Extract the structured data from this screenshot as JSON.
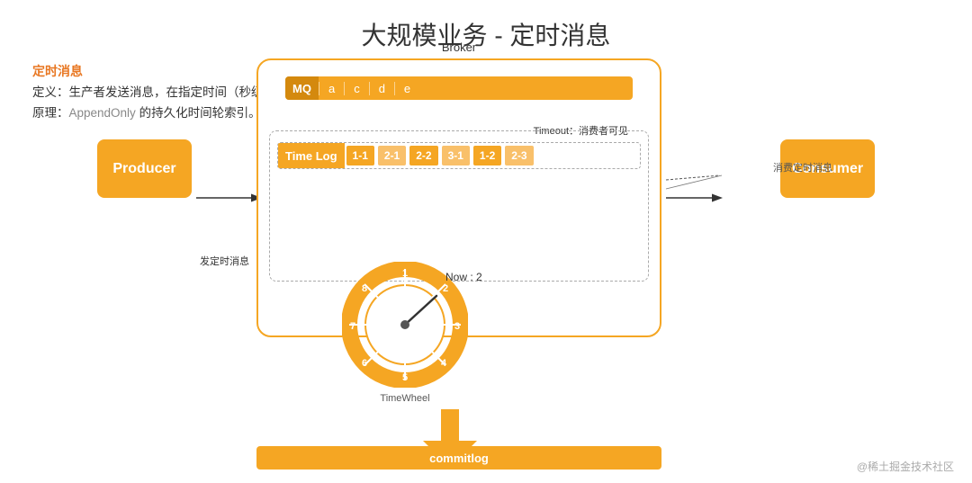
{
  "title": "大规模业务 - 定时消息",
  "section": {
    "heading": "定时消息",
    "line1": "定义：生产者发送消息，在指定时间（秒级）后对消费者可见（常见交易业务，超时订单关闭）；",
    "line2": "原理：AppendOnly 的持久化时间轮索引。"
  },
  "diagram": {
    "broker_label": "Broker",
    "mq_label": "MQ",
    "mq_cells": [
      "a",
      "c",
      "d",
      "e"
    ],
    "timelog_label": "Time Log",
    "timelog_cells": [
      {
        "text": "1-1",
        "alt": false
      },
      {
        "text": "2-1",
        "alt": true
      },
      {
        "text": "2-2",
        "alt": false
      },
      {
        "text": "3-1",
        "alt": true
      },
      {
        "text": "1-2",
        "alt": false
      },
      {
        "text": "2-3",
        "alt": true
      }
    ],
    "timewheel_label": "TimeWheel",
    "timewheel_numbers": [
      "1",
      "2",
      "3",
      "4",
      "5",
      "6",
      "7",
      "8"
    ],
    "now_text": "Now : 2",
    "timeout_text": "Timeout：消费者可见",
    "producer_label": "Producer",
    "producer_arrow_text": "发定时消息",
    "consumer_label": "Consumer",
    "consumer_arrow_text": "消费定时消息",
    "commitlog_label": "commitlog"
  },
  "watermark": "@稀土掘金技术社区",
  "colors": {
    "orange": "#f5a623",
    "dark_orange": "#d4890e",
    "highlight": "#e87722"
  }
}
